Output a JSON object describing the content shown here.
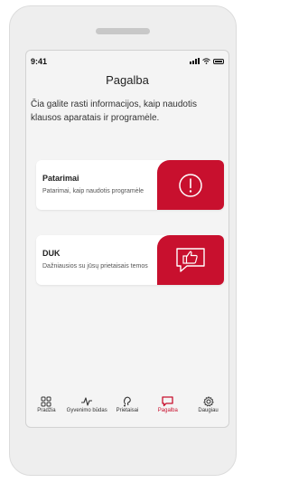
{
  "status_bar": {
    "time": "9:41"
  },
  "header": {
    "title": "Pagalba"
  },
  "intro_text": "Čia galite rasti informacijos, kaip naudotis klausos aparatais ir programėle.",
  "cards": [
    {
      "title": "Patarimai",
      "description": "Patarimai, kaip naudotis programėle",
      "icon": "exclamation-circle-icon"
    },
    {
      "title": "DUK",
      "description": "Dažniausios su jūsų prietaisais temos",
      "icon": "thumbs-up-chat-icon"
    }
  ],
  "tabbar": {
    "items": [
      {
        "label": "Pradžia",
        "icon": "grid-icon",
        "active": false
      },
      {
        "label": "Gyvenimo būdas",
        "icon": "pulse-icon",
        "active": false
      },
      {
        "label": "Prietaisai",
        "icon": "hearing-aid-icon",
        "active": false
      },
      {
        "label": "Pagalba",
        "icon": "chat-bubble-icon",
        "active": true
      },
      {
        "label": "Daugiau",
        "icon": "gear-icon",
        "active": false
      }
    ]
  },
  "colors": {
    "accent": "#c8102e",
    "background": "#f4f4f4",
    "card": "#ffffff"
  }
}
